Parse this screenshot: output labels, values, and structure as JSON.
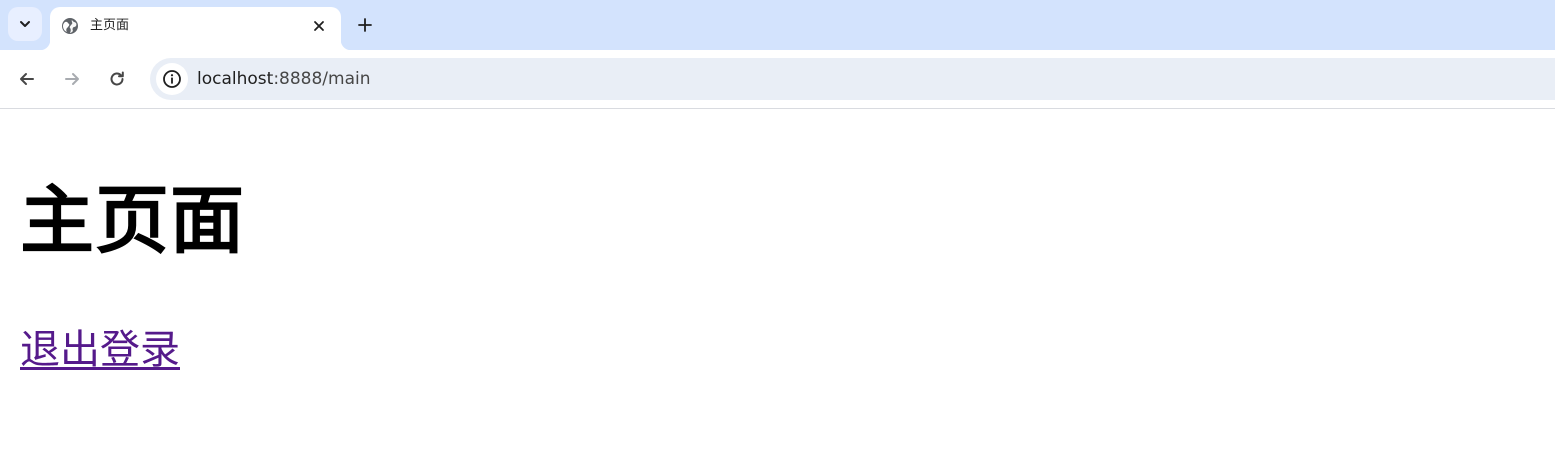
{
  "browser": {
    "tab": {
      "title": "主页面",
      "favicon": "globe-icon"
    },
    "toolbar": {
      "back_icon": "arrow-left-icon",
      "forward_icon": "arrow-right-icon",
      "reload_icon": "reload-icon",
      "site_info_icon": "info-icon"
    },
    "address": {
      "host": "localhost",
      "path": ":8888/main"
    },
    "colors": {
      "tabstrip": "#d3e3fd",
      "omnibox": "#e9eef6",
      "visited_link": "#551a8b"
    }
  },
  "page": {
    "heading": "主页面",
    "logout_link": "退出登录"
  }
}
